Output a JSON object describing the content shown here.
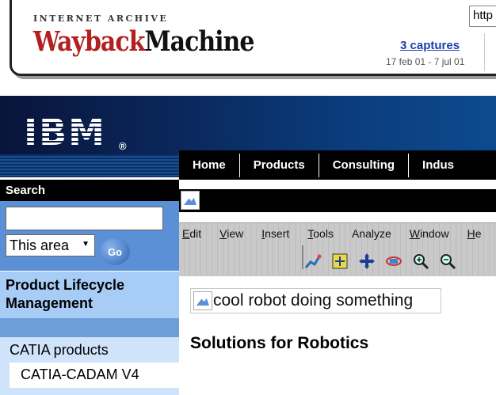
{
  "wayback": {
    "ia_label": "INTERNET ARCHIVE",
    "logo_part1": "Wayback",
    "logo_part2": "Machine",
    "url_value": "http",
    "captures_link": "3 captures",
    "date_range": "17 feb 01 - 7 jul 01"
  },
  "ibm": {
    "logo_text": "IBM",
    "reg_mark": "®"
  },
  "topnav": {
    "items": [
      "Home",
      "Products",
      "Consulting",
      "Indus"
    ]
  },
  "toolbar_image": {
    "menu": [
      {
        "u": "E",
        "rest": "dit"
      },
      {
        "u": "V",
        "rest": "iew"
      },
      {
        "u": "I",
        "rest": "nsert"
      },
      {
        "u": "T",
        "rest": "ools"
      },
      {
        "u": "",
        "rest": "Analyze"
      },
      {
        "u": "W",
        "rest": "indow"
      },
      {
        "u": "H",
        "rest": "e"
      }
    ],
    "icons": [
      "robot-arm-icon",
      "fit-all-icon",
      "pan-icon",
      "rotate-icon",
      "zoom-in-icon",
      "zoom-out-icon"
    ]
  },
  "sidebar": {
    "search_title": "Search",
    "search_value": "",
    "area_select": "This area",
    "go_label": "Go",
    "section_title": "Product Lifecycle Management",
    "nav": [
      "CATIA products",
      "CATIA-CADAM V4"
    ]
  },
  "main": {
    "robot_alt": "cool robot doing something",
    "title": "Solutions for Robotics"
  },
  "colors": {
    "sidebar_blue": "#5b8fd6",
    "plm_head": "#a7cdf6",
    "nav_light": "#cfe4fb",
    "wayback_red": "#b32020",
    "captures_blue": "#1e3fb0"
  }
}
